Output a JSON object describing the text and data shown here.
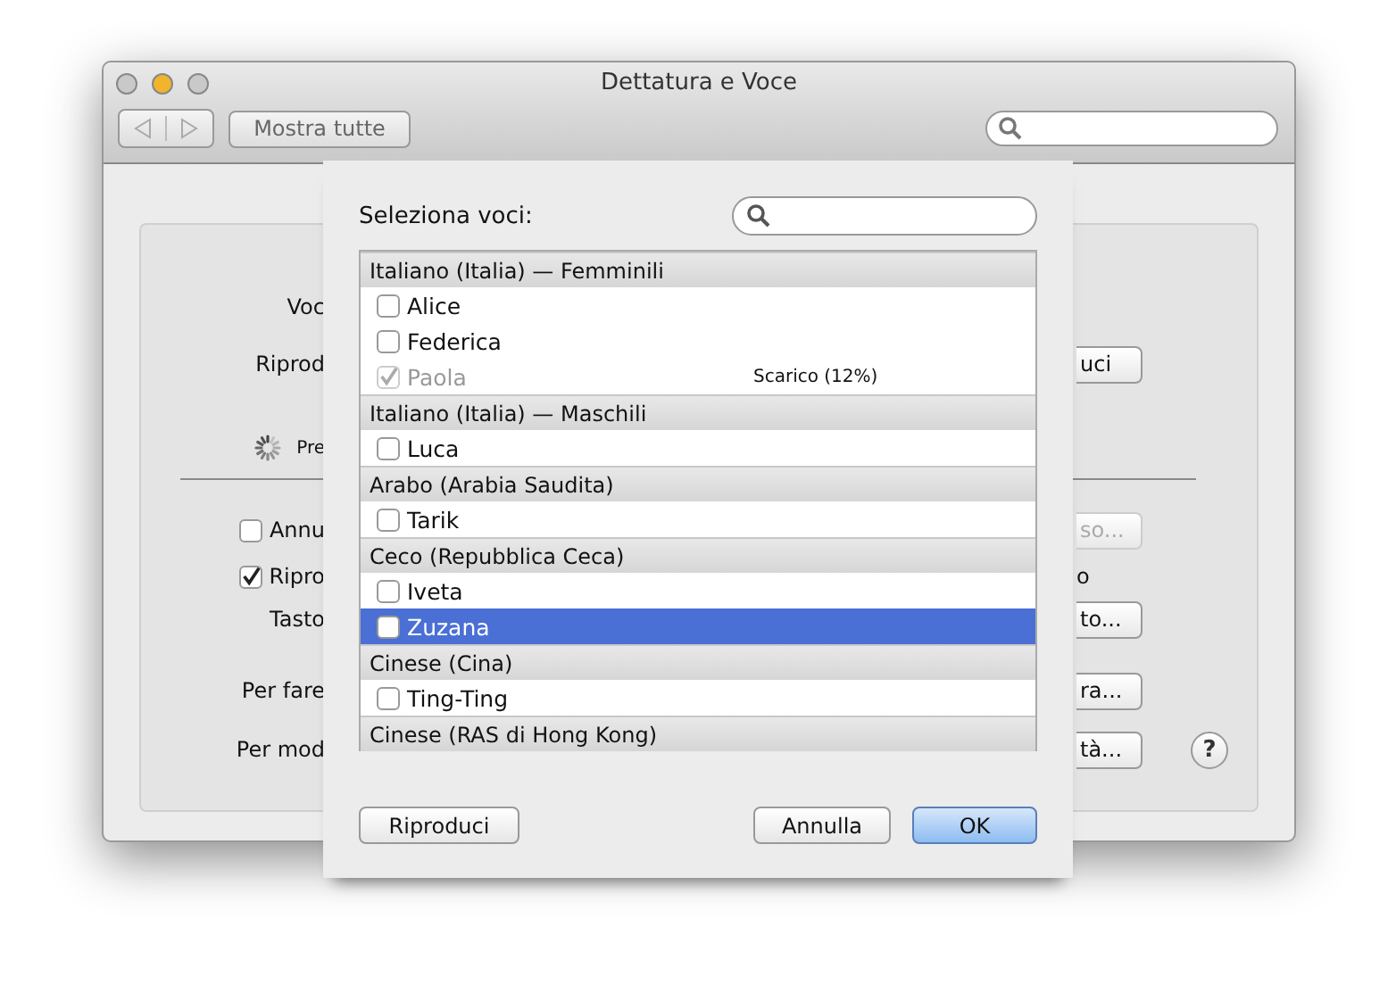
{
  "window": {
    "title": "Dettatura e Voce",
    "traffic_lights": [
      {
        "color": "#c9c9c9"
      },
      {
        "color": "#f2b42a"
      },
      {
        "color": "#c9c9c9"
      }
    ]
  },
  "toolbar": {
    "show_all": "Mostra tutte"
  },
  "background_rows": [
    {
      "kind": "row",
      "left": {
        "kind": "label",
        "text": "Voc"
      }
    },
    {
      "kind": "row",
      "left": {
        "kind": "label",
        "text": "Riprod"
      },
      "right": {
        "kind": "button",
        "text": "uci",
        "disabled": false
      }
    },
    {
      "kind": "row",
      "left": {
        "kind": "spinner",
        "text": "Pre"
      }
    },
    {
      "kind": "divider"
    },
    {
      "kind": "row",
      "left": {
        "kind": "checkbox",
        "text": "Annu",
        "checked": false
      },
      "right": {
        "kind": "button",
        "text": "so...",
        "disabled": true
      }
    },
    {
      "kind": "row",
      "left": {
        "kind": "checkbox",
        "text": "Ripro",
        "checked": true
      },
      "right": {
        "kind": "text",
        "text": "o"
      }
    },
    {
      "kind": "row",
      "left": {
        "kind": "label",
        "text": "Tasto"
      },
      "right": {
        "kind": "button",
        "text": "to...",
        "disabled": false
      }
    },
    {
      "kind": "row",
      "left": {
        "kind": "label",
        "text": "Per fare"
      },
      "right": {
        "kind": "button",
        "text": "ra...",
        "disabled": false
      }
    },
    {
      "kind": "row",
      "left": {
        "kind": "label",
        "text": "Per mod"
      },
      "right": {
        "kind": "button",
        "text": "tà...",
        "disabled": false
      },
      "help": "?"
    }
  ],
  "sheet": {
    "title": "Seleziona voci:",
    "groups": [
      {
        "name": "Italiano (Italia) — Femminili",
        "voices": [
          {
            "name": "Alice",
            "checked": false,
            "disabled": false,
            "selected": false
          },
          {
            "name": "Federica",
            "checked": false,
            "disabled": false,
            "selected": false
          },
          {
            "name": "Paola",
            "checked": true,
            "disabled": true,
            "selected": false,
            "status": "Scarico (12%)"
          }
        ]
      },
      {
        "name": "Italiano (Italia) — Maschili",
        "voices": [
          {
            "name": "Luca",
            "checked": false,
            "disabled": false,
            "selected": false
          }
        ]
      },
      {
        "name": "Arabo (Arabia Saudita)",
        "voices": [
          {
            "name": "Tarik",
            "checked": false,
            "disabled": false,
            "selected": false
          }
        ]
      },
      {
        "name": "Ceco (Repubblica Ceca)",
        "voices": [
          {
            "name": "Iveta",
            "checked": false,
            "disabled": false,
            "selected": false
          },
          {
            "name": "Zuzana",
            "checked": false,
            "disabled": false,
            "selected": true
          }
        ]
      },
      {
        "name": "Cinese (Cina)",
        "voices": [
          {
            "name": "Ting-Ting",
            "checked": false,
            "disabled": false,
            "selected": false
          }
        ]
      },
      {
        "name": "Cinese (RAS di Hong Kong)"
      }
    ],
    "buttons": [
      {
        "text": "Riproduci",
        "kind": "left"
      },
      {
        "text": "Annulla",
        "kind": "cancel"
      },
      {
        "text": "OK",
        "kind": "default"
      }
    ]
  }
}
